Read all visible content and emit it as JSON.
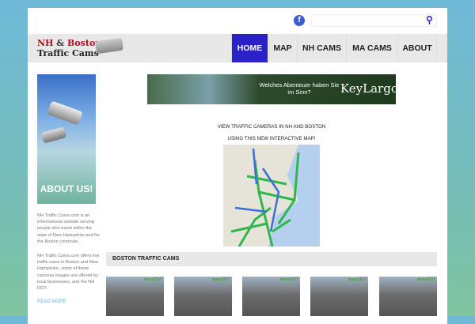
{
  "header": {
    "facebook_icon": "f",
    "search_placeholder": "",
    "search_icon": "search-icon"
  },
  "logo": {
    "line1a": "NH",
    "line1b": " & ",
    "line1c": "Boston",
    "line2": "Traffic Cams"
  },
  "nav": [
    {
      "label": "HOME",
      "active": true
    },
    {
      "label": "MAP"
    },
    {
      "label": "NH CAMS"
    },
    {
      "label": "MA CAMS"
    },
    {
      "label": "ABOUT"
    }
  ],
  "sidebar": {
    "about_label": "ABOUT US!",
    "para1": "NH Traffic Cams.com is an informational website serving people who travel within the state of New Hampshire and for the Boston commute.",
    "para2": "NH Traffic Cams.com offers live traffic cams in Boston and New Hampshire, some of these cameras images are offered by local businesses, and the NH DOT.",
    "read_more": "READ MORE"
  },
  "ad": {
    "text": "Welches Abenteuer haben Sie im Sinn?",
    "brand": "KeyLargo"
  },
  "main": {
    "intro1": "VIEW TRAFFIC CAMERAS IN NH AND BOSTON",
    "intro2": "USING THIS NEW INTERACTIVE MAP!",
    "section_title": "BOSTON TRAFFIC CAMS",
    "thumb_watermark": "massDOT",
    "thumb_count": 5
  },
  "colors": {
    "accent": "#2a22c8",
    "nav_bg": "#e8e8e8"
  }
}
